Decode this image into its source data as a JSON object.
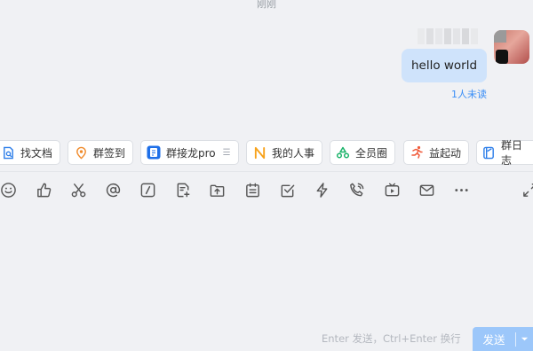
{
  "chat": {
    "timestamp": "刚刚",
    "message": "hello world",
    "read_status": "1人未读"
  },
  "quick_actions": [
    {
      "label": "找文档",
      "icon": "doc-search-icon",
      "color": "#2b7de9"
    },
    {
      "label": "群签到",
      "icon": "location-pin-icon",
      "color": "#f08a2a"
    },
    {
      "label": "群接龙pro",
      "icon": "solitaire-app-icon",
      "color": "#1e6fe8"
    },
    {
      "label": "我的人事",
      "icon": "hr-icon",
      "color": "#f7a21b"
    },
    {
      "label": "全员圈",
      "icon": "recycle-circle-icon",
      "color": "#1bb36a"
    },
    {
      "label": "益起动",
      "icon": "runner-icon",
      "color": "#f05a3a"
    },
    {
      "label": "群日志",
      "icon": "journal-icon",
      "color": "#2b7de9"
    }
  ],
  "toolbar_icons": [
    "emoji-icon",
    "thumbs-up-icon",
    "scissors-icon",
    "at-mention-icon",
    "slash-command-icon",
    "doc-add-icon",
    "upload-file-icon",
    "calendar-note-icon",
    "checkbox-task-icon",
    "lightning-icon",
    "phone-call-icon",
    "live-tv-icon",
    "mail-icon",
    "more-icon",
    "expand-icon"
  ],
  "composer": {
    "hint": "Enter 发送，Ctrl+Enter 换行",
    "send_label": "发送"
  }
}
